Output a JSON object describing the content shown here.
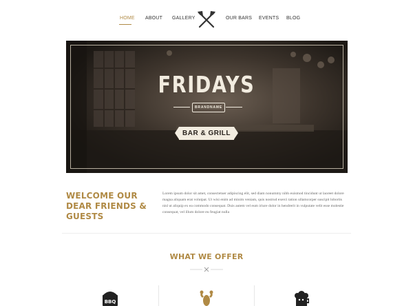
{
  "nav": {
    "items": [
      {
        "label": "HOME",
        "active": true
      },
      {
        "label": "ABOUT"
      },
      {
        "label": "GALLERY"
      },
      {
        "label": "OUR BARS"
      },
      {
        "label": "EVENTS"
      },
      {
        "label": "BLOG"
      }
    ],
    "logo_icon": "crossed-axes-icon",
    "accent_color": "#b08a45"
  },
  "hero": {
    "title": "FRIDAYS",
    "badge": "BRANDNAME",
    "ribbon": "BAR & GRILL"
  },
  "welcome": {
    "title": "WELCOME OUR DEAR FRIENDS & GUESTS",
    "body": "Lorem ipsum dolor sit amet, consectetuer adipiscing elit, sed diam nonummy nibh euismod tincidunt ut laoreet dolore magna aliquam erat volutpat. Ut wisi enim ad minim veniam, quis nostrud exerci tation ullamcorper suscipit lobortis nisl ut aliquip ex ea commodo consequat. Duis autem vel eum iriure dolor in hendrerit in vulputate velit esse molestie consequat, vel illum dolore eu feugiat nulla"
  },
  "offer": {
    "title": "WHAT WE OFFER",
    "icons": [
      "bbq-grill-icon",
      "lobster-icon",
      "beer-mug-icon"
    ],
    "bbq_label": "BBQ"
  }
}
